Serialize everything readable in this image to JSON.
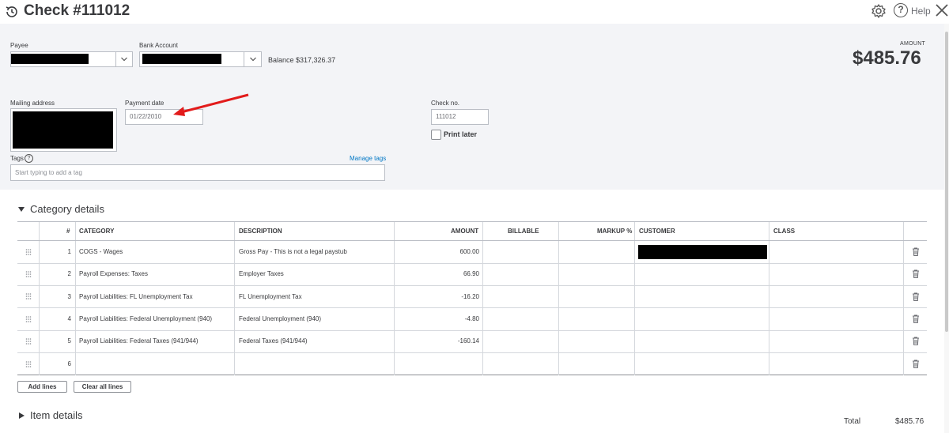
{
  "header": {
    "title": "Check #111012",
    "help_label": "Help"
  },
  "form": {
    "payee_label": "Payee",
    "bank_account_label": "Bank Account",
    "balance_text": "Balance $317,326.37",
    "amount_label": "AMOUNT",
    "amount_value": "$485.76",
    "mailing_address_label": "Mailing address",
    "payment_date_label": "Payment date",
    "payment_date_value": "01/22/2010",
    "check_no_label": "Check no.",
    "check_no_value": "111012",
    "print_later_label": "Print later",
    "tags_label": "Tags",
    "manage_tags_label": "Manage tags",
    "tags_placeholder": "Start typing to add a tag"
  },
  "category_details": {
    "title": "Category details",
    "columns": [
      "#",
      "CATEGORY",
      "DESCRIPTION",
      "AMOUNT",
      "BILLABLE",
      "MARKUP %",
      "CUSTOMER",
      "CLASS"
    ],
    "rows": [
      {
        "n": "1",
        "category": "COGS - Wages",
        "description": "Gross Pay - This is not a legal paystub",
        "amount": "600.00"
      },
      {
        "n": "2",
        "category": "Payroll Expenses: Taxes",
        "description": "Employer Taxes",
        "amount": "66.90"
      },
      {
        "n": "3",
        "category": "Payroll Liabilities: FL Unemployment Tax",
        "description": "FL Unemployment Tax",
        "amount": "-16.20"
      },
      {
        "n": "4",
        "category": "Payroll Liabilities: Federal Unemployment (940)",
        "description": "Federal Unemployment (940)",
        "amount": "-4.80"
      },
      {
        "n": "5",
        "category": "Payroll Liabilities: Federal Taxes (941/944)",
        "description": "Federal Taxes (941/944)",
        "amount": "-160.14"
      },
      {
        "n": "6",
        "category": "",
        "description": "",
        "amount": ""
      }
    ],
    "add_lines_label": "Add lines",
    "clear_lines_label": "Clear all lines"
  },
  "item_details": {
    "title": "Item details"
  },
  "footer": {
    "total_label": "Total",
    "total_value": "$485.76"
  },
  "colors": {
    "form_background": "#f3f4f7",
    "link": "#0077c5",
    "annotation_arrow": "#e21b1b"
  }
}
